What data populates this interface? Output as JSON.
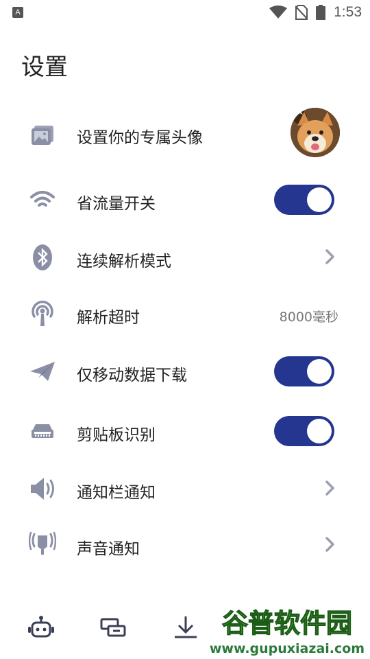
{
  "status_bar": {
    "time": "1:53",
    "indicator": "A"
  },
  "page": {
    "title": "设置"
  },
  "settings": [
    {
      "label": "设置你的专属头像",
      "icon": "image-icon",
      "control": "avatar"
    },
    {
      "label": "省流量开关",
      "icon": "wifi-icon",
      "control": "toggle",
      "on": true
    },
    {
      "label": "连续解析模式",
      "icon": "bluetooth-icon",
      "control": "chevron"
    },
    {
      "label": "解析超时",
      "icon": "antenna-icon",
      "control": "value",
      "value": "8000毫秒"
    },
    {
      "label": "仅移动数据下载",
      "icon": "paper-plane-icon",
      "control": "toggle",
      "on": true
    },
    {
      "label": "剪贴板识别",
      "icon": "chip-icon",
      "control": "toggle",
      "on": true
    },
    {
      "label": "通知栏通知",
      "icon": "speaker-icon",
      "control": "chevron"
    },
    {
      "label": "声音通知",
      "icon": "microphone-icon",
      "control": "chevron"
    }
  ],
  "bottom_nav": [
    "robot-icon",
    "folder-icon",
    "download-icon"
  ],
  "watermark": {
    "line1": "谷普软件园",
    "line2": "www.gupuxiazai.com"
  },
  "colors": {
    "accent": "#24368f",
    "icon": "#8a8fa6"
  }
}
